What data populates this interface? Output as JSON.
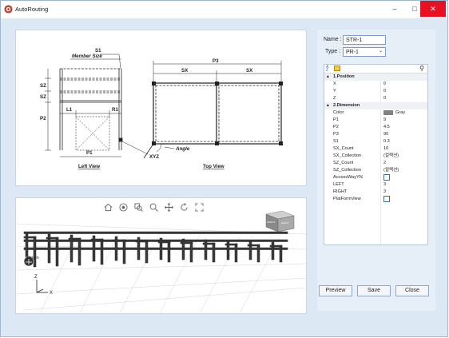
{
  "window": {
    "title": "AutoRouting",
    "min_glyph": "–",
    "max_glyph": "□",
    "close_glyph": "✕"
  },
  "drawing": {
    "s1": "S1",
    "member_size": "Member Size",
    "sz_top": "SZ",
    "sz_bottom": "SZ",
    "p2": "P2",
    "l1": "L1",
    "r1": "R1",
    "p1": "P1",
    "left_view": "Left View",
    "xyz": "XYZ",
    "angle": "Angle",
    "p3": "P3",
    "sx_left": "SX",
    "sx_right": "SX",
    "top_view": "Top View"
  },
  "view3d": {
    "toolbar_icons": [
      "home-icon",
      "eye-icon",
      "zoom-window-icon",
      "zoom-icon",
      "pan-icon",
      "rotate-icon",
      "fit-icon"
    ],
    "cube_labels": [
      "FRONT",
      "RIGHT"
    ],
    "origin_label": "Origin",
    "axis_z": "Z",
    "axis_x": "X"
  },
  "form": {
    "name_label": "Name :",
    "name_value": "STR-1",
    "type_label": "Type :",
    "type_value": "PR-1"
  },
  "property_grid": {
    "categories": [
      {
        "title": "1.Position",
        "rows": [
          {
            "name": "X",
            "value": "0"
          },
          {
            "name": "Y",
            "value": "0"
          },
          {
            "name": "Z",
            "value": "0"
          }
        ]
      },
      {
        "title": "2.Dimension",
        "rows": [
          {
            "name": "Color",
            "value": "Gray",
            "swatch": "#808080"
          },
          {
            "name": "P1",
            "value": "9"
          },
          {
            "name": "P2",
            "value": "4.5"
          },
          {
            "name": "P3",
            "value": "90"
          },
          {
            "name": "S1",
            "value": "0.3"
          },
          {
            "name": "SX_Count",
            "value": "10"
          },
          {
            "name": "SX_Collection",
            "value": "(컬렉션)"
          },
          {
            "name": "SZ_Count",
            "value": "2"
          },
          {
            "name": "SZ_Collection",
            "value": "(컬렉션)"
          },
          {
            "name": "AccessWayYN",
            "value": "",
            "checkbox": true
          },
          {
            "name": "LEFT",
            "value": "3"
          },
          {
            "name": "RIGHT",
            "value": "3"
          },
          {
            "name": "PlatFormView",
            "value": "",
            "checkbox": true
          }
        ]
      }
    ]
  },
  "buttons": {
    "preview": "Preview",
    "save": "Save",
    "close": "Close"
  },
  "colors": {
    "window_bg": "#dce8f4",
    "close_red": "#e81123",
    "accent_blue": "#3a6ea5"
  }
}
